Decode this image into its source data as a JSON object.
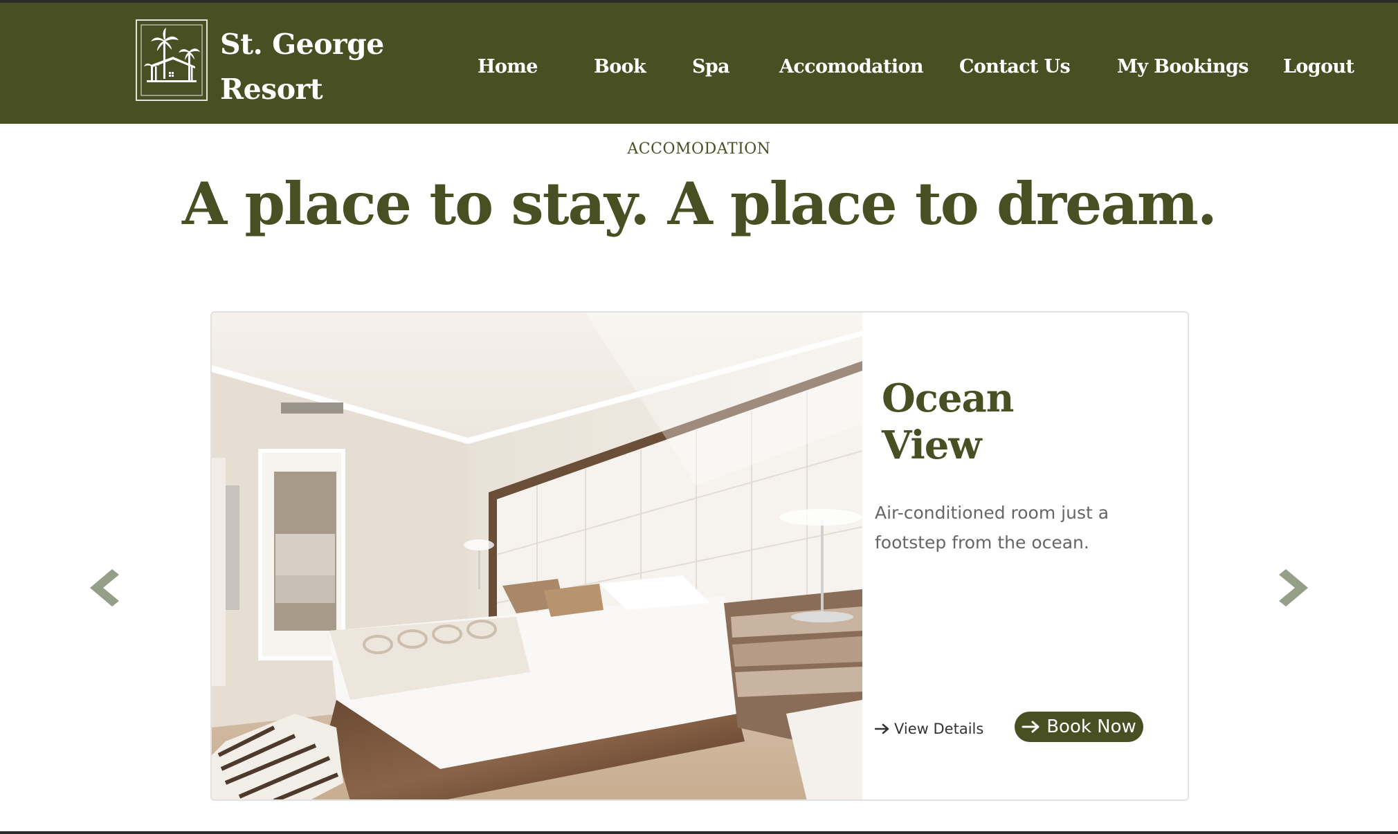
{
  "header": {
    "brand_line1": "St. George",
    "brand_line2": "Resort",
    "logo_icon": "palm-house-logo",
    "background": "#474f23"
  },
  "nav": {
    "items": [
      {
        "label": "Home"
      },
      {
        "label": "Book"
      },
      {
        "label": "Spa"
      },
      {
        "label": "Accomodation"
      },
      {
        "label": "Contact Us"
      },
      {
        "label": "My Bookings"
      },
      {
        "label": "Logout"
      }
    ]
  },
  "section": {
    "eyebrow": "ACCOMODATION",
    "headline": "A place to stay. A place to dream."
  },
  "carousel": {
    "prev_icon": "chevron-left-icon",
    "next_icon": "chevron-right-icon",
    "slide": {
      "title_line1": "Ocean",
      "title_line2": "View",
      "description": "Air-conditioned room just a footstep from the ocean.",
      "view_details_label": "View Details",
      "book_now_label": "Book Now",
      "arrow_icon": "arrow-right-icon"
    }
  },
  "colors": {
    "brand": "#474f23",
    "arrow": "#959e86",
    "text_muted": "#666666"
  }
}
